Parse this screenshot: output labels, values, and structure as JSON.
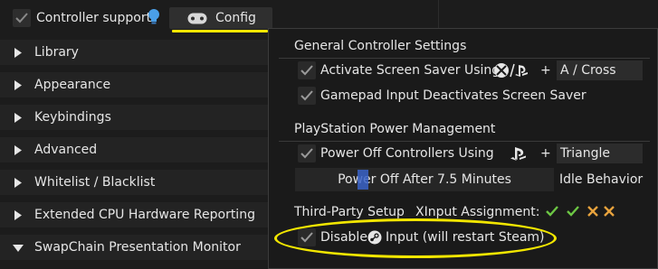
{
  "top": {
    "controller_support_label": "Controller support",
    "config_label": "Config",
    "config_icon": "gamepad-icon",
    "hint_icon": "lightbulb-icon"
  },
  "sidebar": {
    "items": [
      {
        "label": "Library",
        "expanded": false
      },
      {
        "label": "Appearance",
        "expanded": false
      },
      {
        "label": "Keybindings",
        "expanded": false
      },
      {
        "label": "Advanced",
        "expanded": false
      },
      {
        "label": "Whitelist / Blacklist",
        "expanded": false
      },
      {
        "label": "Extended CPU Hardware Reporting",
        "expanded": false
      },
      {
        "label": "SwapChain Presentation Monitor",
        "expanded": true
      }
    ]
  },
  "popup": {
    "general": {
      "title": "General Controller Settings",
      "screen_saver_label": "Activate Screen Saver Using",
      "screen_saver_button_icon": "xbox-playstation-icon",
      "screen_saver_plus": "+",
      "screen_saver_combo": "A / Cross",
      "deactivate_label": "Gamepad Input Deactivates Screen Saver"
    },
    "power": {
      "title": "PlayStation Power Management",
      "power_off_label": "Power Off Controllers Using",
      "power_off_button_icon": "playstation-icon",
      "power_off_plus": "+",
      "power_off_combo": "Triangle",
      "slider_text": "Power Off After 7.5 Minutes",
      "slider_suffix": "Idle Behavior"
    },
    "third_party": {
      "title": "Third-Party Setup",
      "xinput_label": "XInput Assignment:",
      "xinput_slots": [
        "check",
        "check",
        "cross",
        "cross"
      ],
      "disable_label_prefix": "Disable",
      "disable_icon": "steam-icon",
      "disable_label_suffix": "Input (will restart Steam)"
    }
  },
  "colors": {
    "highlight_yellow": "#f2e600",
    "check_green": "#6cc644",
    "cross_orange": "#e8a33d",
    "bulb_blue": "#4a9fe8"
  }
}
